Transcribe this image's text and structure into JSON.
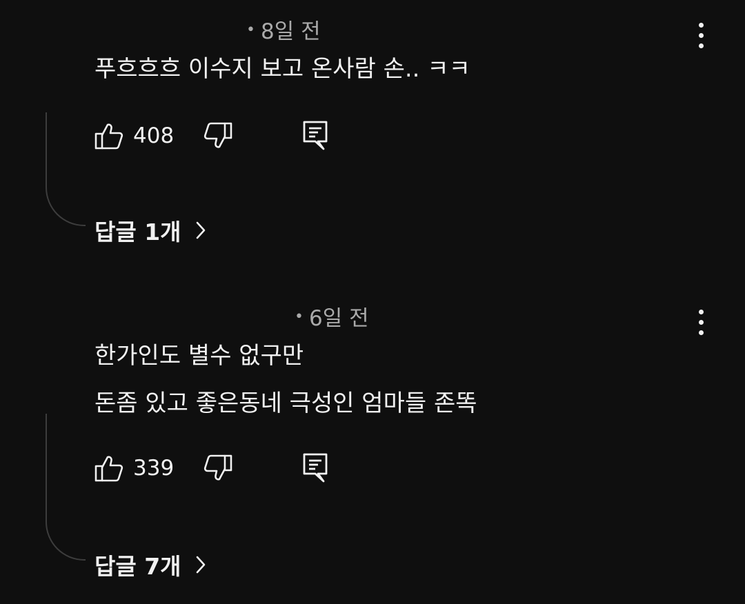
{
  "comments": [
    {
      "time": "8일 전",
      "lines": [
        "푸흐흐흐 이수지 보고 온사람 손.. ㅋㅋ"
      ],
      "likes": "408",
      "replies_label": "답글 1개"
    },
    {
      "time": "6일 전",
      "lines": [
        "한가인도 별수 없구만",
        "돈좀 있고 좋은동네 극성인 엄마들 존똑"
      ],
      "likes": "339",
      "replies_label": "답글 7개"
    }
  ],
  "meta_dot": "•",
  "icons": {
    "like": "thumbs-up-icon",
    "dislike": "thumbs-down-icon",
    "reply": "comment-icon",
    "more": "more-vert-icon",
    "chevron": "chevron-right-icon"
  },
  "colors": {
    "background": "#0f0f0f",
    "text": "#f1f1f1",
    "secondary_text": "#aaaaaa",
    "thread_line": "#3d3d3d"
  }
}
